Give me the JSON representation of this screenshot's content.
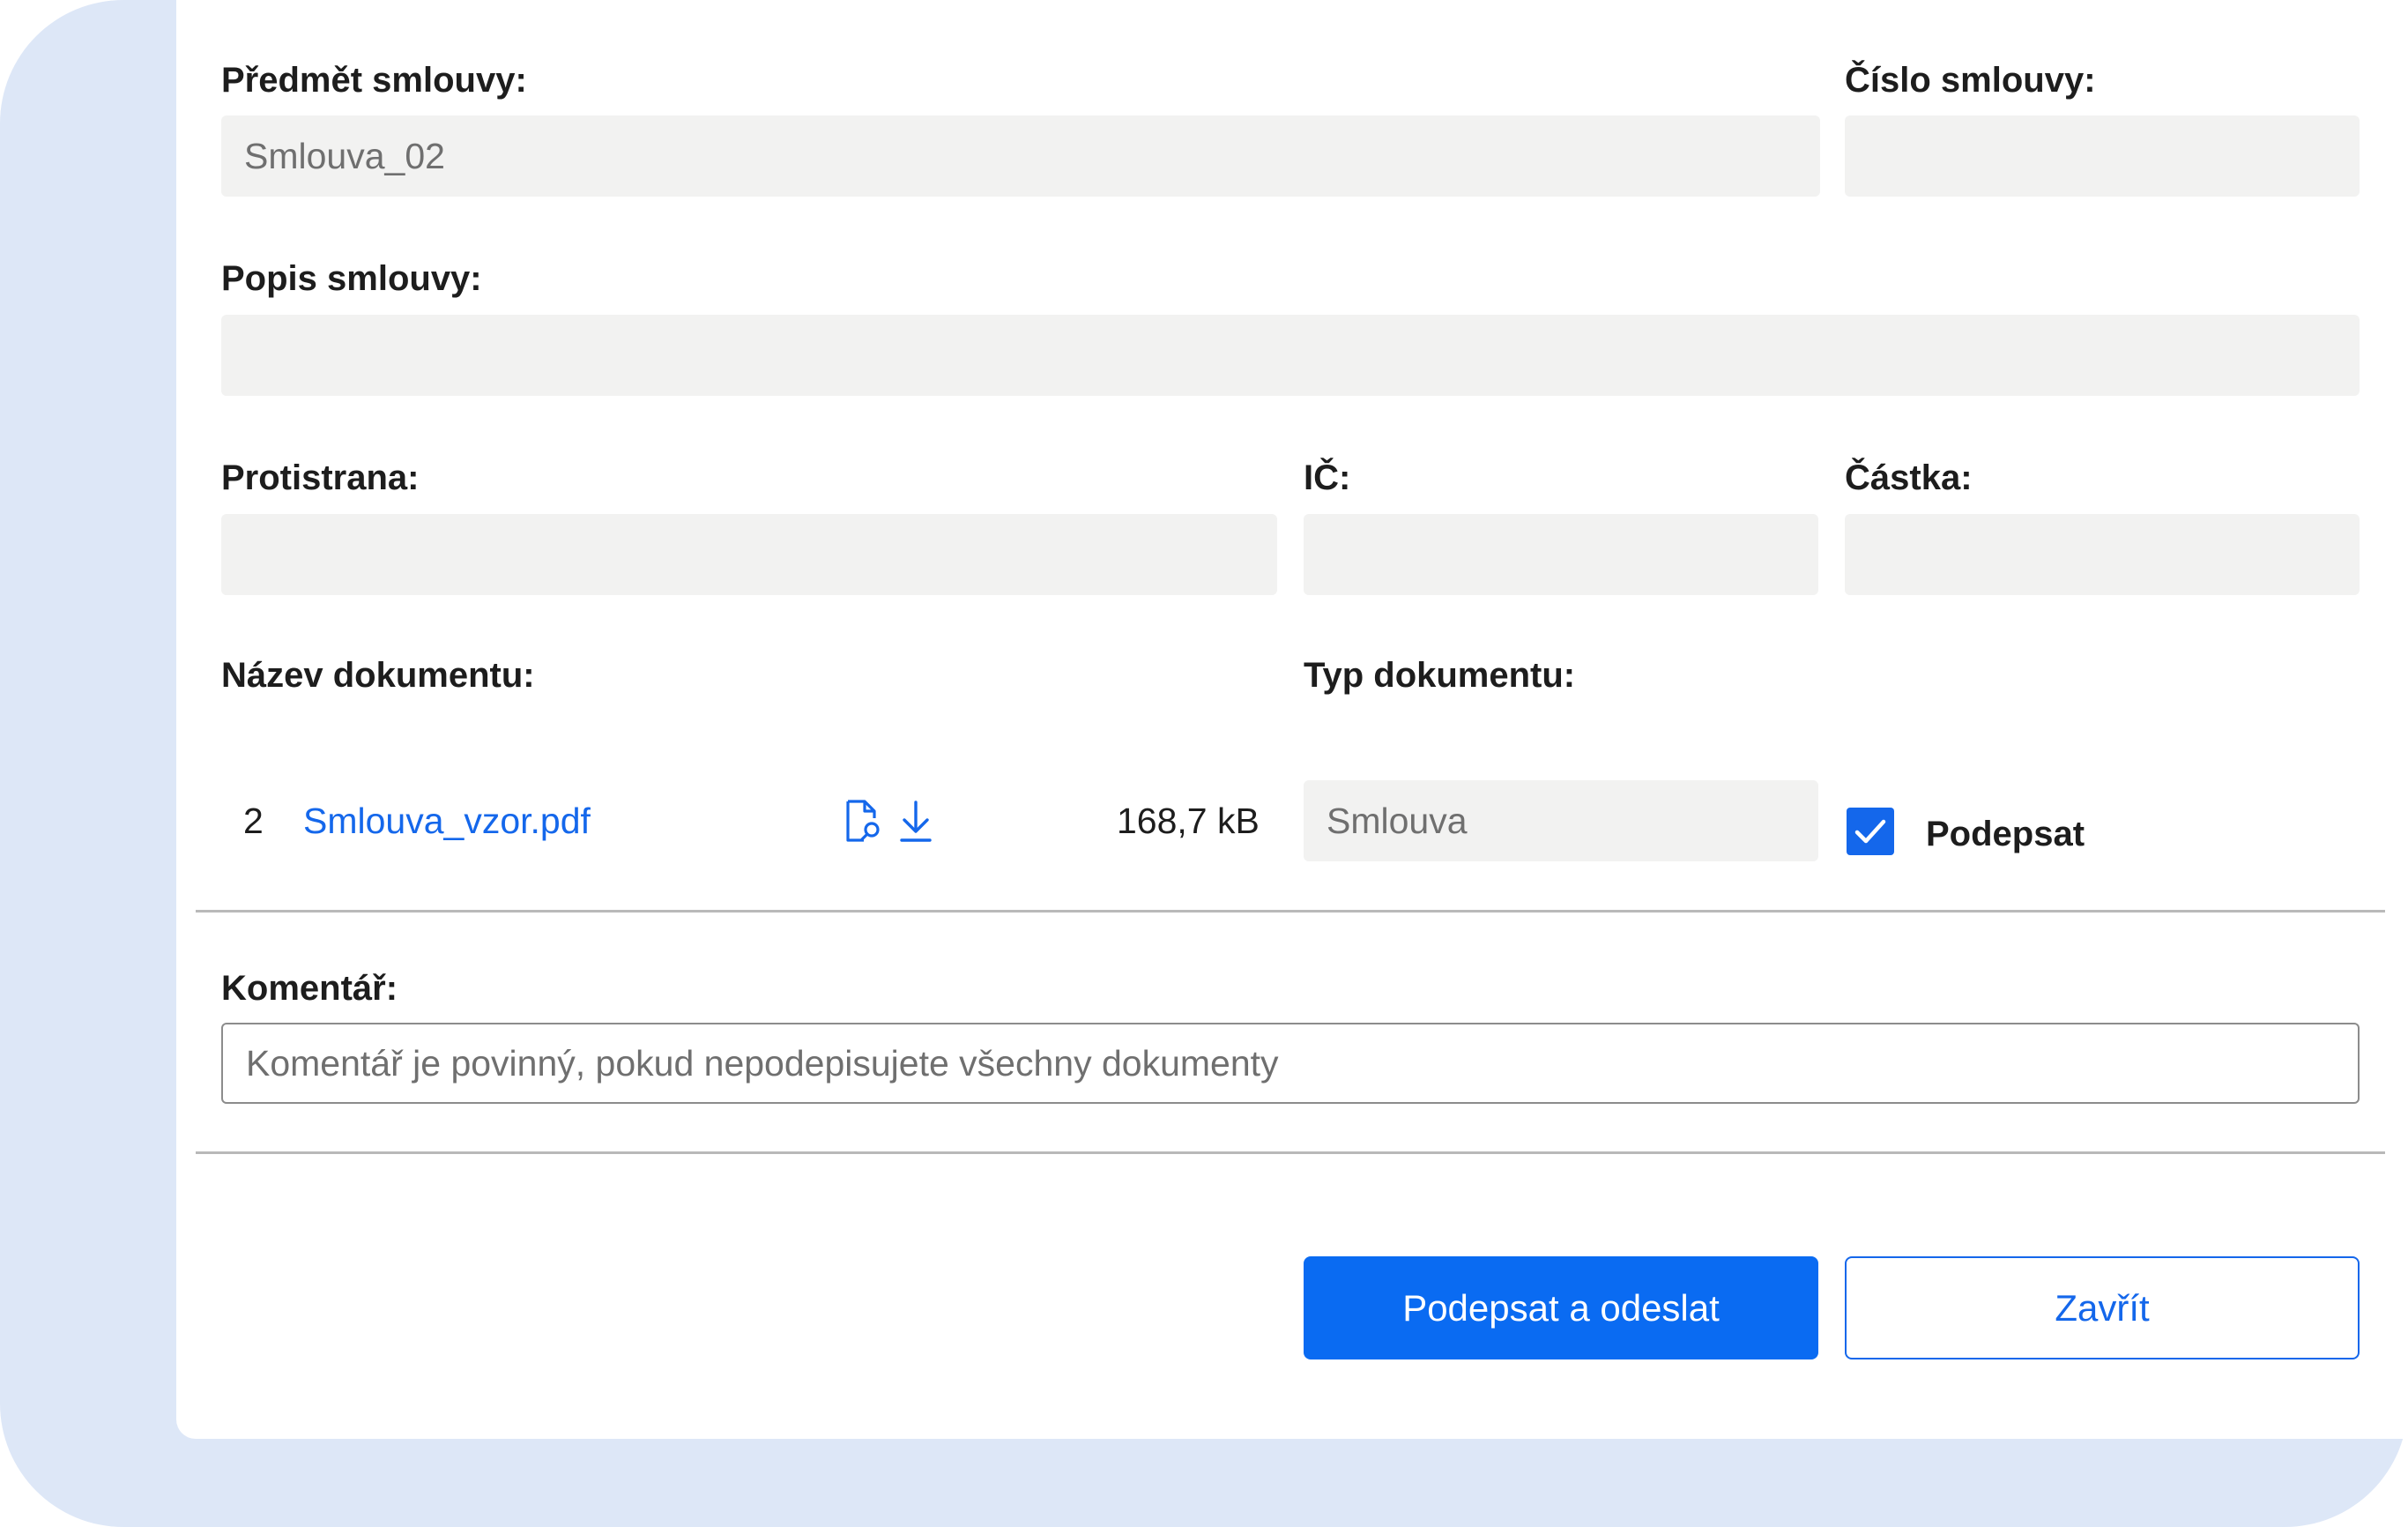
{
  "form": {
    "subject": {
      "label": "Předmět smlouvy:",
      "value": "Smlouva_02"
    },
    "contract_number": {
      "label": "Číslo smlouvy:",
      "value": ""
    },
    "description": {
      "label": "Popis smlouvy:",
      "value": ""
    },
    "counterparty": {
      "label": "Protistrana:",
      "value": ""
    },
    "ic": {
      "label": "IČ:",
      "value": ""
    },
    "amount": {
      "label": "Částka:",
      "value": ""
    },
    "document_name_label": "Název dokumentu:",
    "document_type_label": "Typ dokumentu:"
  },
  "document": {
    "number": "2",
    "name": "Smlouva_vzor.pdf",
    "size": "168,7 kB",
    "type": "Smlouva",
    "sign_checked": true,
    "sign_label": "Podepsat"
  },
  "comment": {
    "label": "Komentář:",
    "placeholder": "Komentář je povinný, pokud nepodepisujete všechny dokumenty",
    "value": ""
  },
  "actions": {
    "primary_label": "Podepsat a odeslat",
    "secondary_label": "Zavřít"
  },
  "colors": {
    "accent": "#0a6bf2",
    "field_bg": "#f2f2f1",
    "frame_bg": "#dde7f7"
  },
  "icons": {
    "preview": "document-search-icon",
    "download": "download-icon",
    "check": "checkmark-icon"
  }
}
